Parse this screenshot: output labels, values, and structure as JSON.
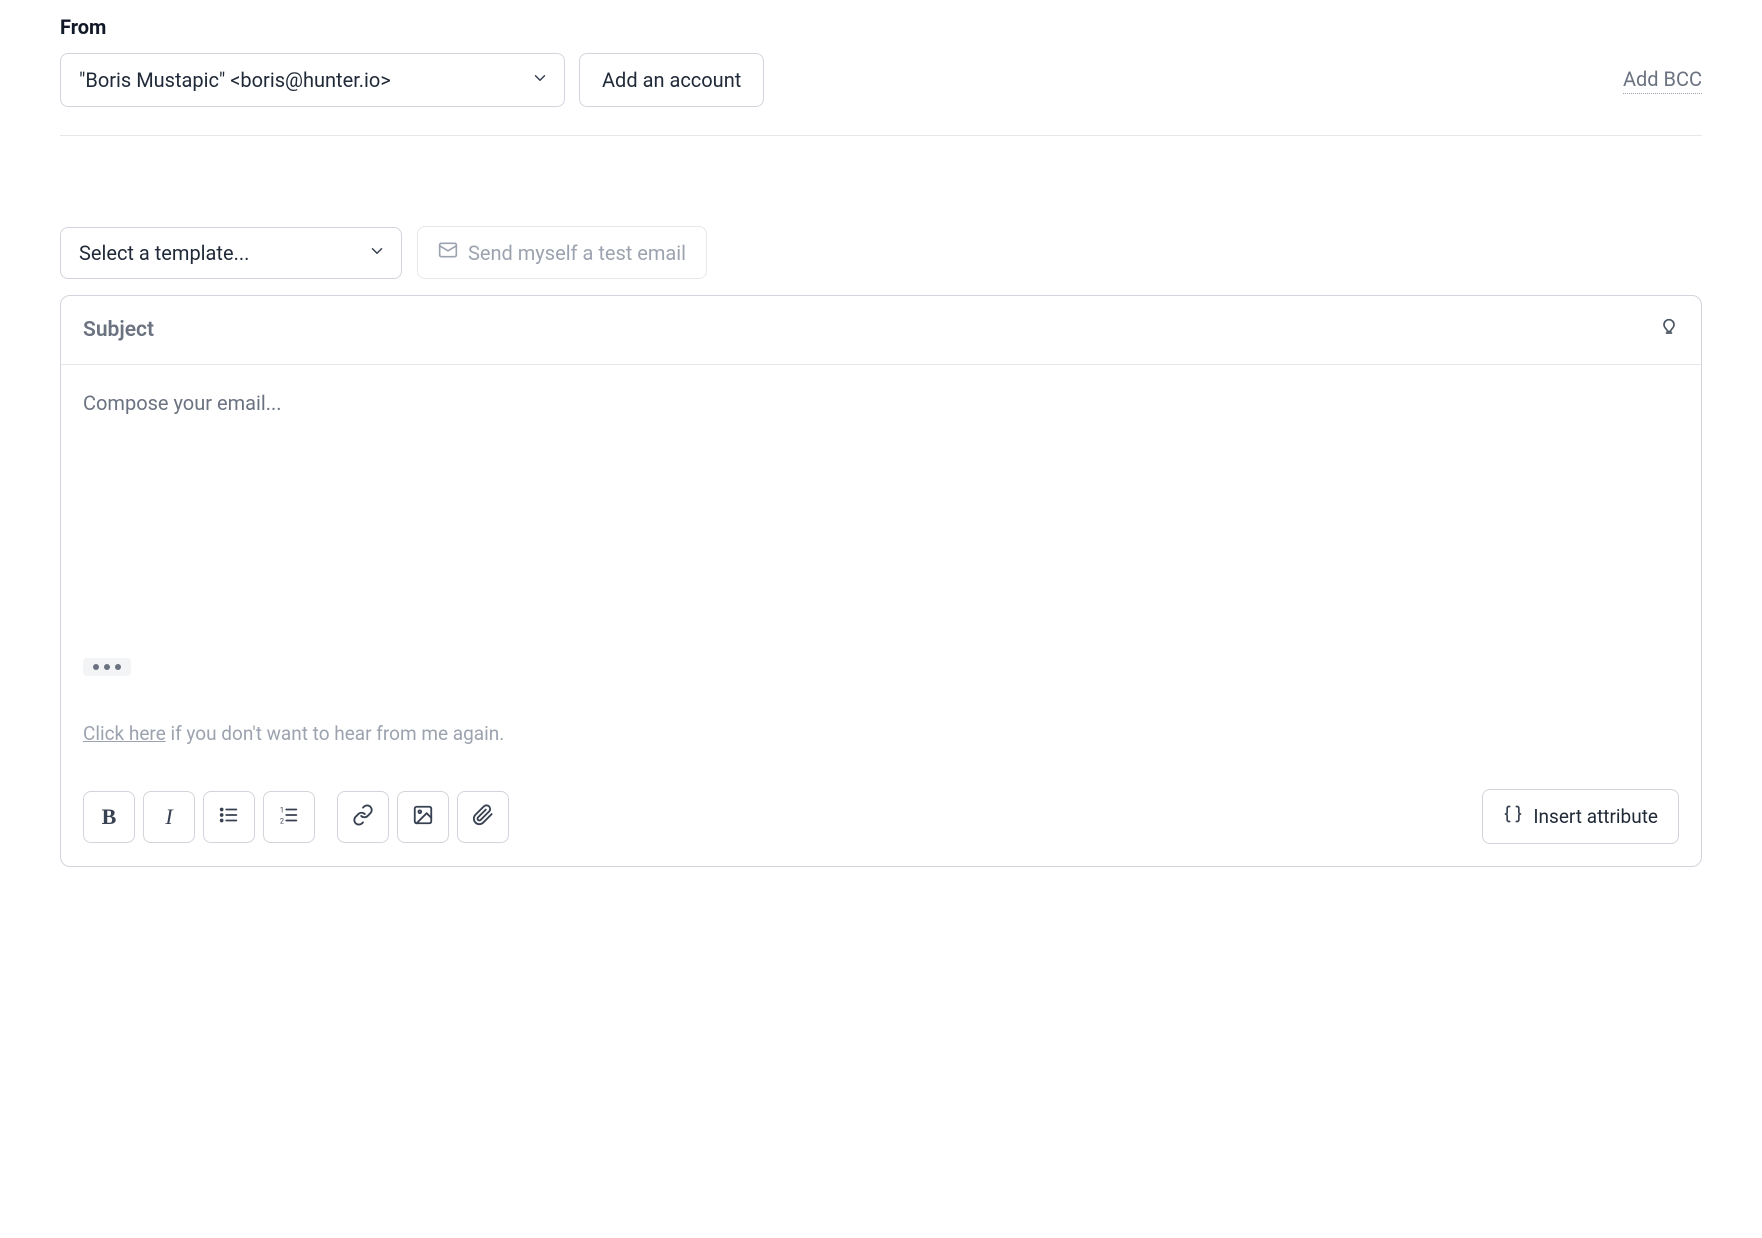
{
  "from": {
    "label": "From",
    "selected": "\"Boris Mustapic\" <boris@hunter.io>",
    "add_account_label": "Add an account",
    "add_bcc_label": "Add BCC"
  },
  "template": {
    "placeholder": "Select a template...",
    "test_email_label": "Send myself a test email"
  },
  "editor": {
    "subject_placeholder": "Subject",
    "compose_placeholder": "Compose your email...",
    "unsub_link_text": "Click here",
    "unsub_tail_text": " if you don't want to hear from me again.",
    "insert_attribute_label": "Insert attribute"
  },
  "toolbar": {
    "bold": "B",
    "italic": "I"
  }
}
